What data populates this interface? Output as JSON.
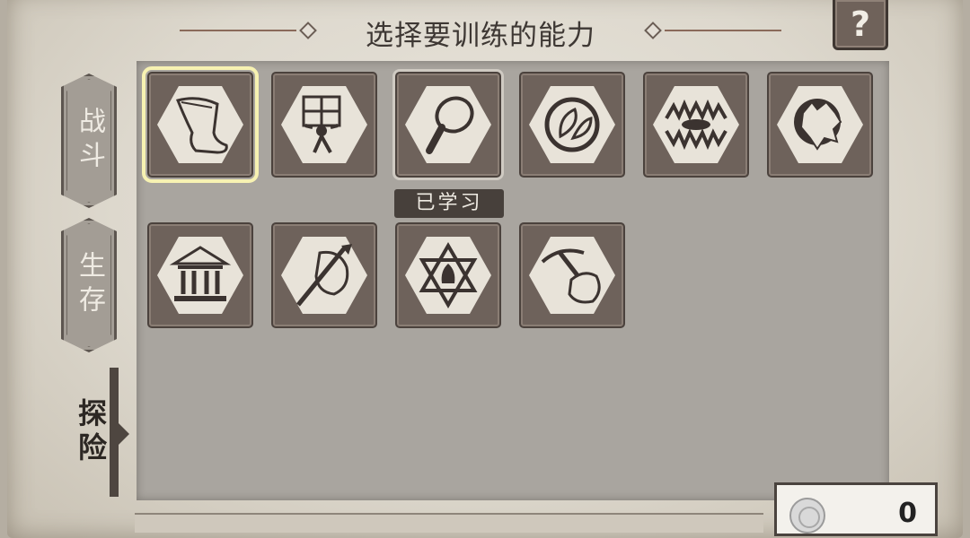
{
  "header": {
    "title": "选择要训练的能力",
    "help_label": "?"
  },
  "categories": [
    {
      "label": "战斗",
      "state": "inactive"
    },
    {
      "label": "生存",
      "state": "inactive"
    },
    {
      "label": "探险",
      "state": "active"
    }
  ],
  "skills": [
    {
      "icon": "leg-icon",
      "state": "selected"
    },
    {
      "icon": "carry-crates-icon",
      "state": "normal"
    },
    {
      "icon": "magnifying-glass-icon",
      "state": "learned"
    },
    {
      "icon": "leaf-recycle-icon",
      "state": "normal"
    },
    {
      "icon": "bear-trap-icon",
      "state": "normal"
    },
    {
      "icon": "wolf-head-icon",
      "state": "normal"
    },
    {
      "icon": "museum-building-icon",
      "state": "normal"
    },
    {
      "icon": "spear-rock-icon",
      "state": "normal"
    },
    {
      "icon": "star-leaf-emblem-icon",
      "state": "normal"
    },
    {
      "icon": "pickaxe-ore-icon",
      "state": "normal"
    }
  ],
  "learned_badge": "已学习",
  "currency": {
    "icon": "coin-icon",
    "value": "0"
  },
  "colors": {
    "tile_bg": "#6e625b",
    "hex_bg": "#e8e3d9",
    "selection_highlight": "#f7f2b2",
    "panel_bg": "#a9a59f"
  }
}
